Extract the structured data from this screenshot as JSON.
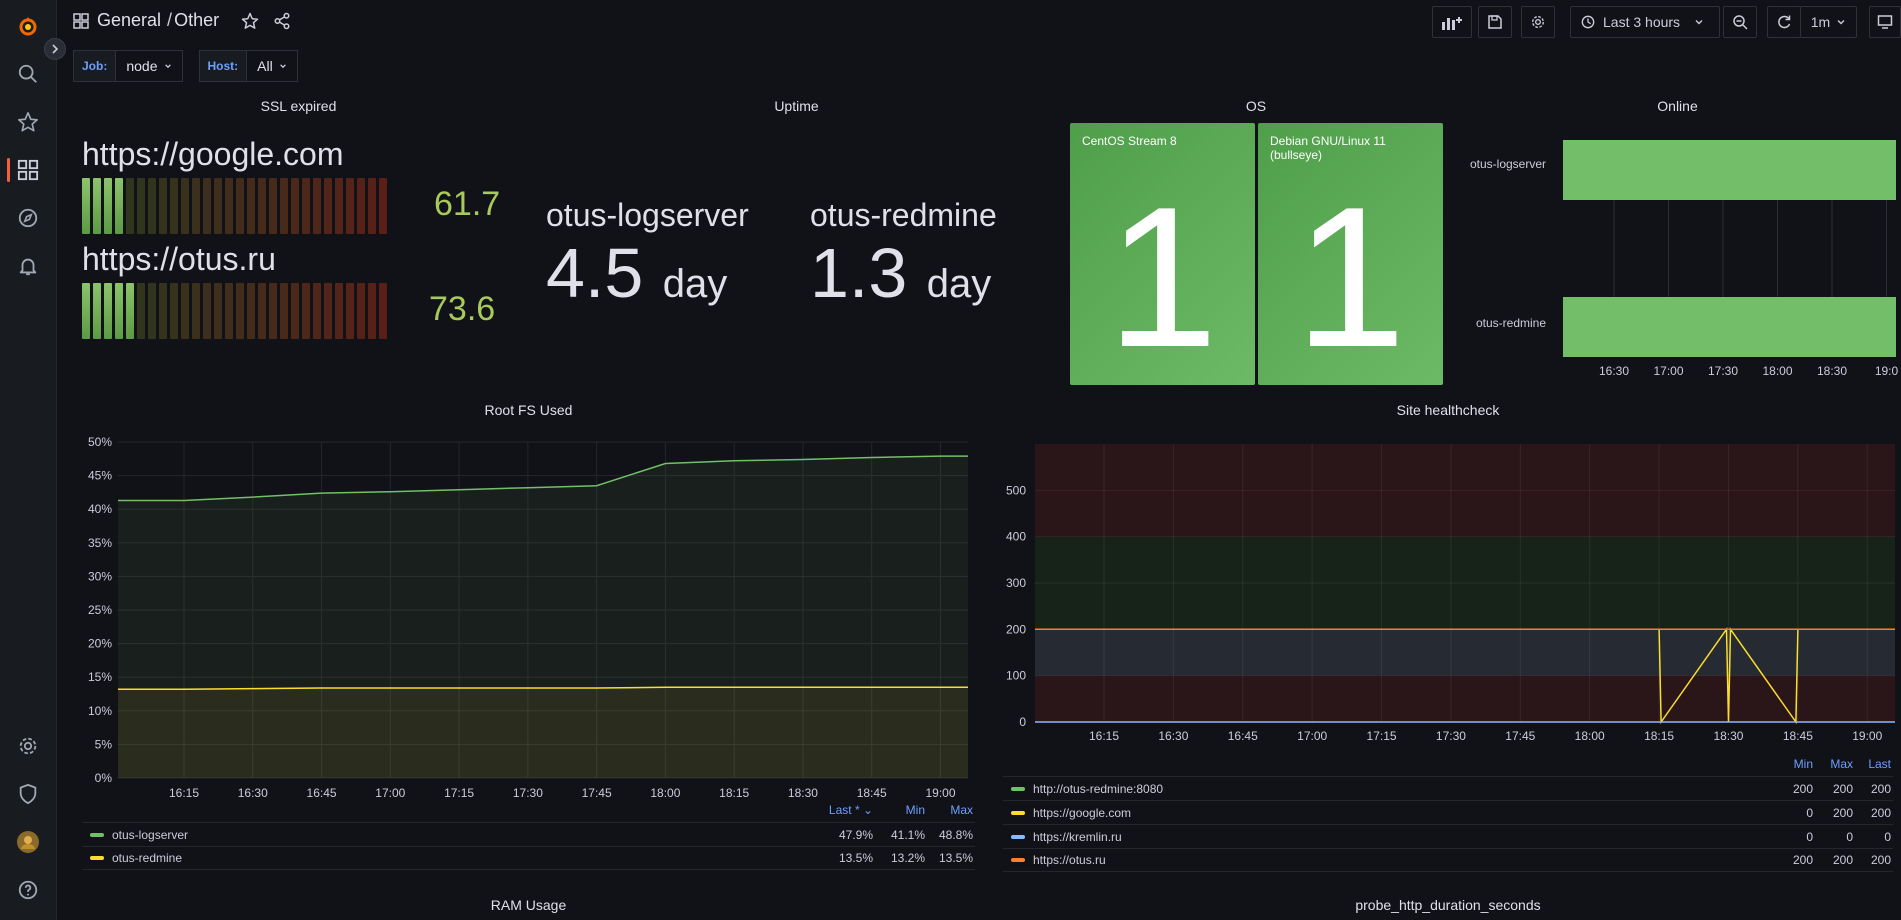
{
  "breadcrumb": {
    "folder": "General",
    "separator": "/",
    "dashboard": "Other"
  },
  "toolbar": {
    "time_range": "Last 3 hours",
    "refresh_interval": "1m"
  },
  "variables": [
    {
      "label": "Job:",
      "value": "node"
    },
    {
      "label": "Host:",
      "value": "All"
    }
  ],
  "panels": {
    "ssl": {
      "title": "SSL expired",
      "items": [
        {
          "url": "https://google.com",
          "value": "61.7",
          "fill": 0.14
        },
        {
          "url": "https://otus.ru",
          "value": "73.6",
          "fill": 0.18
        }
      ]
    },
    "uptime": {
      "title": "Uptime",
      "items": [
        {
          "host": "otus-logserver",
          "value": "4.5",
          "unit": "day"
        },
        {
          "host": "otus-redmine",
          "value": "1.3",
          "unit": "day"
        }
      ]
    },
    "os": {
      "title": "OS",
      "tiles": [
        {
          "name": "CentOS Stream 8",
          "count": "1"
        },
        {
          "name": "Debian GNU/Linux 11 (bullseye)",
          "count": "1"
        }
      ]
    },
    "online": {
      "title": "Online",
      "rows": [
        "otus-logserver",
        "otus-redmine"
      ],
      "x_ticks": [
        "16:30",
        "17:00",
        "17:30",
        "18:00",
        "18:30",
        "19:0"
      ],
      "color": "#73bf69"
    },
    "rootfs": {
      "title": "Root FS Used",
      "legend_headers": {
        "last": "Last *",
        "min": "Min",
        "max": "Max"
      },
      "legend": [
        {
          "name": "otus-logserver",
          "last": "47.9%",
          "min": "41.1%",
          "max": "48.8%",
          "color": "#73bf69"
        },
        {
          "name": "otus-redmine",
          "last": "13.5%",
          "min": "13.2%",
          "max": "13.5%",
          "color": "#fade2a"
        }
      ]
    },
    "health": {
      "title": "Site healthcheck",
      "legend_headers": {
        "min": "Min",
        "max": "Max",
        "last": "Last"
      },
      "legend": [
        {
          "name": "http://otus-redmine:8080",
          "min": "200",
          "max": "200",
          "last": "200",
          "color": "#73bf69"
        },
        {
          "name": "https://google.com",
          "min": "0",
          "max": "200",
          "last": "200",
          "color": "#fade2a"
        },
        {
          "name": "https://kremlin.ru",
          "min": "0",
          "max": "0",
          "last": "0",
          "color": "#8ab8ff"
        },
        {
          "name": "https://otus.ru",
          "min": "200",
          "max": "200",
          "last": "200",
          "color": "#ff7f2a"
        }
      ]
    },
    "ram": {
      "title": "RAM Usage"
    },
    "probe": {
      "title": "probe_http_duration_seconds"
    }
  },
  "chart_data": [
    {
      "type": "line",
      "title": "Root FS Used",
      "x": [
        "16:15",
        "16:30",
        "16:45",
        "17:00",
        "17:15",
        "17:30",
        "17:45",
        "18:00",
        "18:15",
        "18:30",
        "18:45",
        "19:00"
      ],
      "ylim": [
        0,
        50
      ],
      "y_ticks": [
        "0%",
        "5%",
        "10%",
        "15%",
        "20%",
        "25%",
        "30%",
        "35%",
        "40%",
        "45%",
        "50%"
      ],
      "series": [
        {
          "name": "otus-logserver",
          "values": [
            41.3,
            41.8,
            42.4,
            42.6,
            42.9,
            43.2,
            43.5,
            46.8,
            47.2,
            47.4,
            47.7,
            47.9
          ]
        },
        {
          "name": "otus-redmine",
          "values": [
            13.2,
            13.3,
            13.4,
            13.4,
            13.4,
            13.4,
            13.4,
            13.5,
            13.5,
            13.5,
            13.5,
            13.5
          ]
        }
      ]
    },
    {
      "type": "line",
      "title": "Site healthcheck",
      "x": [
        "16:15",
        "16:30",
        "16:45",
        "17:00",
        "17:15",
        "17:30",
        "17:45",
        "18:00",
        "18:15",
        "18:30",
        "18:45",
        "19:00"
      ],
      "ylim": [
        0,
        600
      ],
      "y_ticks": [
        "0",
        "100",
        "200",
        "300",
        "400",
        "500"
      ],
      "series": [
        {
          "name": "http://otus-redmine:8080",
          "values": [
            200,
            200,
            200,
            200,
            200,
            200,
            200,
            200,
            200,
            200,
            200,
            200
          ]
        },
        {
          "name": "https://google.com",
          "values": [
            200,
            200,
            200,
            200,
            200,
            200,
            200,
            200,
            200,
            0,
            200,
            200
          ]
        },
        {
          "name": "https://kremlin.ru",
          "values": [
            0,
            0,
            0,
            0,
            0,
            0,
            0,
            0,
            0,
            0,
            0,
            0
          ]
        },
        {
          "name": "https://otus.ru",
          "values": [
            200,
            200,
            200,
            200,
            200,
            200,
            200,
            200,
            200,
            200,
            200,
            200
          ]
        }
      ]
    }
  ]
}
